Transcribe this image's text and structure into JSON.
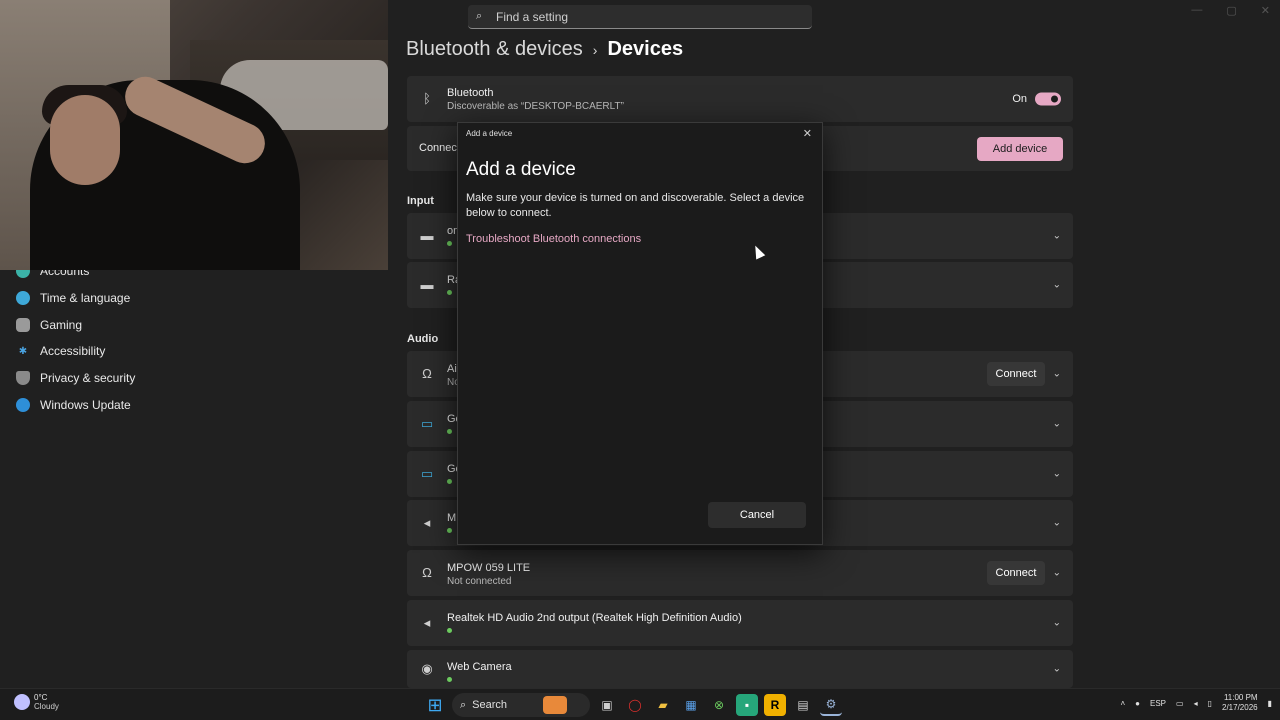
{
  "search": {
    "placeholder": "Find a setting"
  },
  "breadcrumb": {
    "parent": "Bluetooth & devices",
    "current": "Devices"
  },
  "sidebar": {
    "items": [
      {
        "label": "Accounts",
        "icon": "accounts-icon"
      },
      {
        "label": "Time & language",
        "icon": "globe-clock-icon"
      },
      {
        "label": "Gaming",
        "icon": "gamepad-icon"
      },
      {
        "label": "Accessibility",
        "icon": "accessibility-icon"
      },
      {
        "label": "Privacy & security",
        "icon": "shield-icon"
      },
      {
        "label": "Windows Update",
        "icon": "update-icon"
      }
    ]
  },
  "bluetooth": {
    "title": "Bluetooth",
    "subtitle": "Discoverable as “DESKTOP-BCAERLT”",
    "state_label": "On"
  },
  "connect_row": {
    "label": "Connect",
    "button": "Add device"
  },
  "sections": {
    "input": "Input",
    "audio": "Audio"
  },
  "input_devices": [
    {
      "name": "on",
      "icon": "keyboard-icon"
    },
    {
      "name": "Ra",
      "icon": "keyboard-icon"
    }
  ],
  "audio_devices": [
    {
      "name": "Ai",
      "status": "No",
      "icon": "headphones-icon",
      "action": "Connect"
    },
    {
      "name": "Ge",
      "icon": "monitor-icon"
    },
    {
      "name": "Ge",
      "icon": "monitor-icon"
    },
    {
      "name": "M",
      "icon": "speaker-icon"
    },
    {
      "name": "MPOW 059 LITE",
      "status": "Not connected",
      "icon": "headphones-icon",
      "action": "Connect"
    },
    {
      "name": "Realtek HD Audio 2nd output (Realtek High Definition Audio)",
      "icon": "speaker-icon"
    },
    {
      "name": "Web Camera",
      "icon": "webcam-icon"
    }
  ],
  "dialog": {
    "window_title": "Add a device",
    "heading": "Add a device",
    "description": "Make sure your device is turned on and discoverable. Select a device below to connect.",
    "link": "Troubleshoot Bluetooth connections",
    "cancel": "Cancel"
  },
  "taskbar": {
    "weather_temp": "0°C",
    "weather_cond": "Cloudy",
    "search_label": "Search",
    "lang": "ESP",
    "time": "11:00 PM",
    "date": "2/17/2026"
  },
  "colors": {
    "accent": "#e6a8c4",
    "online_dot": "#6ccb5f"
  }
}
